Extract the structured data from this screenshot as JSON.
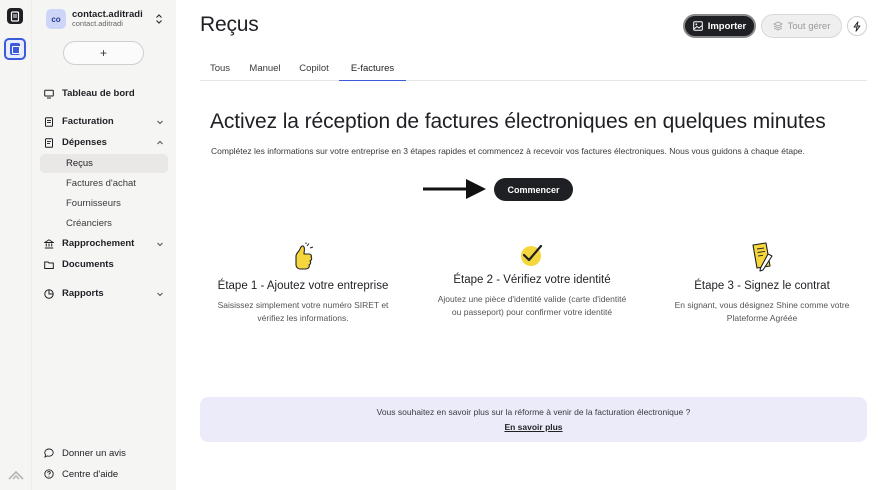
{
  "account": {
    "initials": "co",
    "name": "contact.aditradi",
    "handle": "contact.aditradi"
  },
  "sidebar": {
    "new_button": "+",
    "dashboard": "Tableau de bord",
    "billing": "Facturation",
    "expenses": "Dépenses",
    "expenses_items": [
      "Reçus",
      "Factures d'achat",
      "Fournisseurs",
      "Créanciers"
    ],
    "reconciliation": "Rapprochement",
    "documents": "Documents",
    "reports": "Rapports",
    "feedback": "Donner un avis",
    "help": "Centre d'aide"
  },
  "header": {
    "title": "Reçus",
    "import_label": "Importer",
    "manage_label": "Tout gérer"
  },
  "tabs": [
    "Tous",
    "Manuel",
    "Copilot",
    "E-factures"
  ],
  "active_tab": "E-factures",
  "hero": {
    "title": "Activez la réception de factures électroniques en quelques minutes",
    "subtitle": "Complétez les informations sur votre entreprise en 3 étapes rapides et commencez à recevoir vos factures électroniques. Nous vous guidons à chaque étape.",
    "start_label": "Commencer"
  },
  "steps": [
    {
      "title": "Étape 1 - Ajoutez votre entreprise",
      "desc": "Saisissez simplement votre numéro SIRET et vérifiez les informations.",
      "icon": "thumbs-up-icon"
    },
    {
      "title": "Étape 2 - Vérifiez votre identité",
      "desc": "Ajoutez une pièce d'identité valide (carte d'identité ou passeport) pour confirmer votre identité",
      "icon": "checkmark-icon"
    },
    {
      "title": "Étape 3 - Signez le contrat",
      "desc": "En signant, vous désignez Shine comme votre Plateforme Agréée",
      "icon": "sign-document-icon"
    }
  ],
  "info": {
    "text": "Vous souhaitez en savoir plus sur la réforme à venir de la facturation électronique ?",
    "link": "En savoir plus"
  },
  "colors": {
    "accent": "#3b5bdb",
    "dark": "#1f2024",
    "illustration_yellow": "#f5d63d",
    "info_bg": "#ecebfa"
  }
}
